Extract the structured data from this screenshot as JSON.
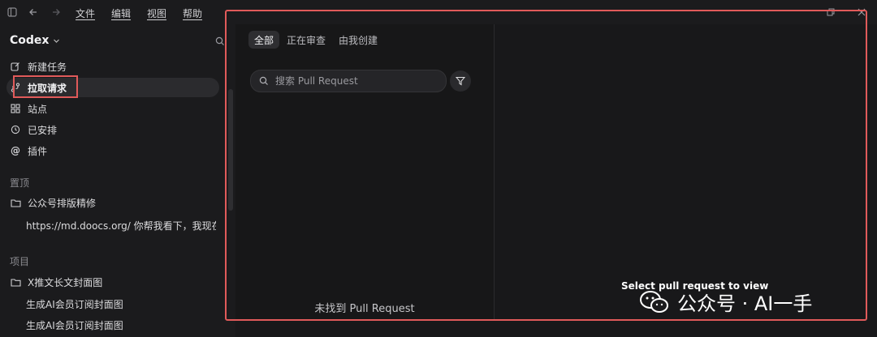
{
  "titlebar": {
    "menu": [
      "文件",
      "编辑",
      "视图",
      "帮助"
    ]
  },
  "sidebar": {
    "workspace": "Codex",
    "nav": [
      {
        "label": "新建任务",
        "icon": "edit-icon"
      },
      {
        "label": "拉取请求",
        "icon": "pull-request-icon"
      },
      {
        "label": "站点",
        "icon": "sites-icon"
      },
      {
        "label": "已安排",
        "icon": "clock-icon"
      },
      {
        "label": "插件",
        "icon": "at-icon"
      }
    ],
    "pinned_title": "置顶",
    "pinned": [
      {
        "label": "公众号排版精修",
        "icon": "folder-icon"
      },
      {
        "label": "https://md.doocs.org/ 你帮我看下，我现在这"
      }
    ],
    "projects_title": "项目",
    "projects": [
      {
        "label": "X推文长文封面图",
        "icon": "folder-icon"
      },
      {
        "label": "生成AI会员订阅封面图"
      },
      {
        "label": "生成AI会员订阅封面图"
      }
    ]
  },
  "main": {
    "tabs": [
      "全部",
      "正在审查",
      "由我创建"
    ],
    "active_tab": "全部",
    "search_placeholder": "搜索 Pull Request",
    "empty_message": "未找到 Pull Request",
    "detail_empty": "Select pull request to view"
  },
  "watermark": "公众号 · AI一手",
  "colors": {
    "highlight_frame": "#e05a5a",
    "background": "#1b1b1d",
    "active_row": "#2b2b2e"
  }
}
